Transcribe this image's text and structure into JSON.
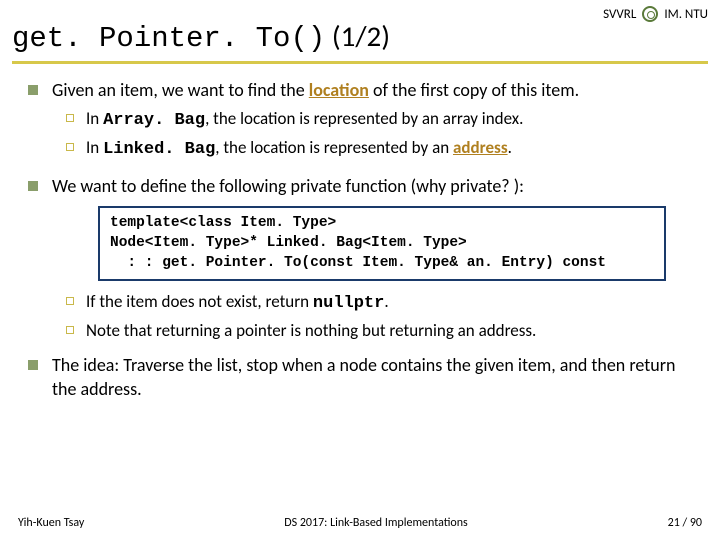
{
  "header": {
    "org_left": "SVVRL",
    "org_right": "IM. NTU"
  },
  "title": {
    "code": "get. Pointer. To()",
    "page": "(1/2)"
  },
  "bullets": {
    "b1a_pre": "Given an item, we want to find the ",
    "b1a_loc": "location",
    "b1a_post": " of the first copy of this item.",
    "b2a_pre": "In ",
    "b2a_class": "Array. Bag",
    "b2a_post": ", the location is represented by an array index.",
    "b2b_pre": "In ",
    "b2b_class": "Linked. Bag",
    "b2b_mid": ", the location is represented by an ",
    "b2b_addr": "address",
    "b2b_end": ".",
    "b1b": "We want to define the following private function (why private? ):",
    "b2c_pre": "If the item does not exist, return ",
    "b2c_code": "nullptr",
    "b2c_post": ".",
    "b2d": "Note that returning a pointer is nothing but returning an address.",
    "b1c": "The idea: Traverse the list, stop when a node contains the given item, and then return the address."
  },
  "codebox": "template<class Item. Type>\nNode<Item. Type>* Linked. Bag<Item. Type>\n  : : get. Pointer. To(const Item. Type& an. Entry) const",
  "footer": {
    "author": "Yih-Kuen Tsay",
    "course": "DS 2017: Link-Based Implementations",
    "page": "21 / 90"
  }
}
